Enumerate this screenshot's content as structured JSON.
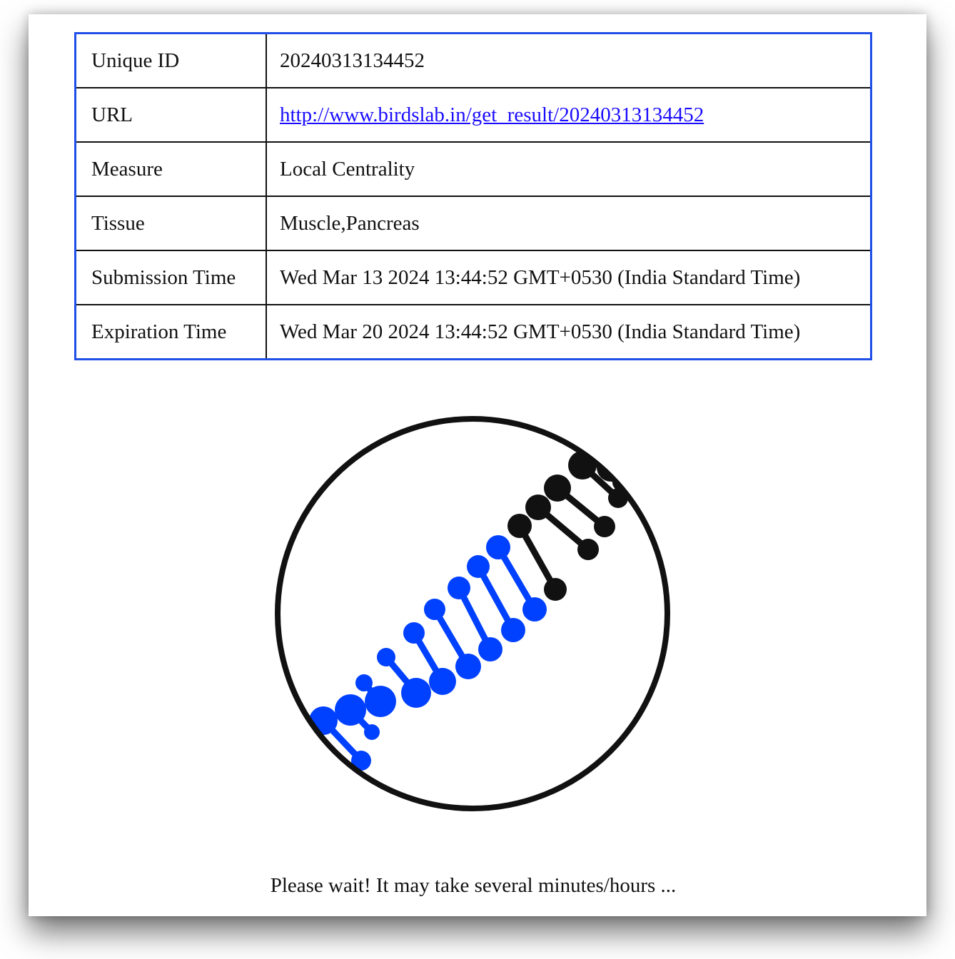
{
  "table": {
    "rows": [
      {
        "key": "Unique ID",
        "value": "20240313134452"
      },
      {
        "key": "URL",
        "value": "http://www.birdslab.in/get_result/20240313134452"
      },
      {
        "key": "Measure",
        "value": "Local Centrality"
      },
      {
        "key": "Tissue",
        "value": "Muscle,Pancreas"
      },
      {
        "key": "Submission Time",
        "value": "Wed Mar 13 2024 13:44:52 GMT+0530 (India Standard Time)"
      },
      {
        "key": "Expiration Time",
        "value": "Wed Mar 20 2024 13:44:52 GMT+0530 (India Standard Time)"
      }
    ]
  },
  "loader": {
    "icon": "dna-loading-icon",
    "colors": {
      "primary": "#0040ff",
      "secondary": "#111111",
      "ring": "#111111"
    }
  },
  "status": {
    "message": "Please wait! It may take several minutes/hours ..."
  },
  "colors": {
    "table_border": "#1f4fe6",
    "link": "#1a0dff"
  }
}
